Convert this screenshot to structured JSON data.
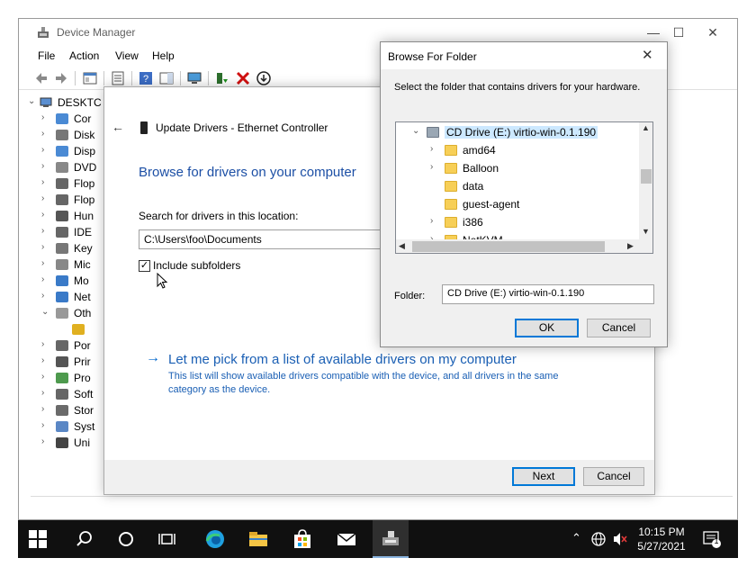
{
  "device_manager": {
    "title": "Device Manager",
    "caption_minimize": "—",
    "caption_maximize": "☐",
    "caption_close": "✕",
    "menu": [
      "File",
      "Action",
      "View",
      "Help"
    ],
    "tree": {
      "root_label": "DESKTC",
      "items": [
        {
          "label": "Cor",
          "icon": "computer-icon"
        },
        {
          "label": "Disk",
          "icon": "disk-icon"
        },
        {
          "label": "Disp",
          "icon": "display-icon"
        },
        {
          "label": "DVD",
          "icon": "dvd-icon"
        },
        {
          "label": "Flop",
          "icon": "floppy-icon"
        },
        {
          "label": "Flop",
          "icon": "floppy-icon"
        },
        {
          "label": "Hun",
          "icon": "hid-icon"
        },
        {
          "label": "IDE",
          "icon": "ide-icon"
        },
        {
          "label": "Key",
          "icon": "keyboard-icon"
        },
        {
          "label": "Mic",
          "icon": "mouse-icon"
        },
        {
          "label": "Mo",
          "icon": "monitor-icon"
        },
        {
          "label": "Net",
          "icon": "network-icon"
        },
        {
          "label": "Oth",
          "icon": "other-devices-icon"
        },
        {
          "label": "",
          "icon": "warning-device-icon"
        },
        {
          "label": "Por",
          "icon": "port-icon"
        },
        {
          "label": "Prir",
          "icon": "printer-icon"
        },
        {
          "label": "Pro",
          "icon": "processor-icon"
        },
        {
          "label": "Soft",
          "icon": "software-icon"
        },
        {
          "label": "Stor",
          "icon": "storage-icon"
        },
        {
          "label": "Syst",
          "icon": "system-icon"
        },
        {
          "label": "Uni",
          "icon": "usb-icon"
        }
      ]
    }
  },
  "update_drivers": {
    "header": "Update Drivers - Ethernet Controller",
    "heading": "Browse for drivers on your computer",
    "search_label": "Search for drivers in this location:",
    "path_value": "C:\\Users\\foo\\Documents",
    "include_subfolders_label": "Include subfolders",
    "include_subfolders_checked": true,
    "pick_link": "Let me pick from a list of available drivers on my computer",
    "pick_desc": "This list will show available drivers compatible with the device, and all drivers in the same category as the device.",
    "next_label": "Next",
    "cancel_label": "Cancel"
  },
  "browse_folder": {
    "title": "Browse For Folder",
    "instruction": "Select the folder that contains drivers for your hardware.",
    "tree": [
      {
        "label": "CD Drive (E:) virtio-win-0.1.190",
        "selected": true,
        "expanded": true,
        "has_children": true,
        "level": 0,
        "icon": "cd-drive-icon"
      },
      {
        "label": "amd64",
        "has_children": true,
        "level": 1,
        "icon": "folder-icon"
      },
      {
        "label": "Balloon",
        "has_children": true,
        "level": 1,
        "icon": "folder-icon"
      },
      {
        "label": "data",
        "has_children": false,
        "level": 1,
        "icon": "folder-icon"
      },
      {
        "label": "guest-agent",
        "has_children": false,
        "level": 1,
        "icon": "folder-icon"
      },
      {
        "label": "i386",
        "has_children": true,
        "level": 1,
        "icon": "folder-icon"
      },
      {
        "label": "NetKVM",
        "has_children": true,
        "level": 1,
        "icon": "folder-icon"
      }
    ],
    "folder_label": "Folder:",
    "folder_value": "CD Drive (E:) virtio-win-0.1.190",
    "ok_label": "OK",
    "cancel_label": "Cancel"
  },
  "taskbar": {
    "time": "10:15 PM",
    "date": "5/27/2021",
    "notification_count": "1"
  }
}
